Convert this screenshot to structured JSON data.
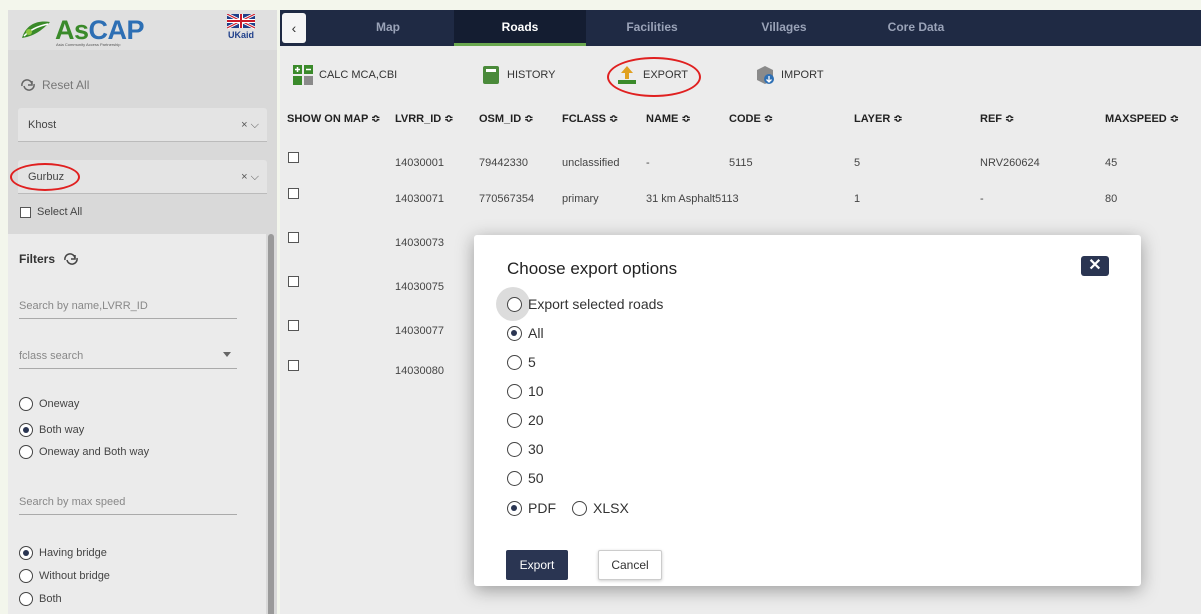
{
  "brand": {
    "logo_text_a": "As",
    "logo_text_b": "CAP",
    "tagline": "Asia Community Access Partnership",
    "ukaid": "UKaid"
  },
  "sidebar": {
    "reset_label": "Reset All",
    "province_value": "Khost",
    "district_value": "Gurbuz",
    "clear_symbol": "×",
    "select_all_label": "Select All",
    "filters_title": "Filters",
    "search_placeholder": "Search by name,LVRR_ID",
    "fclass_placeholder": "fclass search",
    "direction_options": [
      {
        "label": "Oneway",
        "selected": false
      },
      {
        "label": "Both way",
        "selected": true
      },
      {
        "label": "Oneway and Both way",
        "selected": false
      }
    ],
    "max_speed_placeholder": "Search by max speed",
    "bridge_options": [
      {
        "label": "Having bridge",
        "selected": true
      },
      {
        "label": "Without bridge",
        "selected": false
      },
      {
        "label": "Both",
        "selected": false
      }
    ]
  },
  "tabs": [
    {
      "label": "Map",
      "active": false
    },
    {
      "label": "Roads",
      "active": true
    },
    {
      "label": "Facilities",
      "active": false
    },
    {
      "label": "Villages",
      "active": false
    },
    {
      "label": "Core Data",
      "active": false
    }
  ],
  "toolbar": {
    "calc_label": "CALC MCA,CBI",
    "history_label": "HISTORY",
    "export_label": "EXPORT",
    "import_label": "IMPORT"
  },
  "table": {
    "headers": [
      "SHOW ON MAP ≎",
      "LVRR_ID ≎",
      "OSM_ID ≎",
      "FCLASS ≎",
      "NAME ≎",
      "CODE ≎",
      "LAYER ≎",
      "REF ≎",
      "MAXSPEED ≎"
    ],
    "rows": [
      {
        "lvrr_id": "14030001",
        "osm_id": "79442330",
        "fclass": "unclassified",
        "name": "-",
        "code": "5115",
        "layer": "5",
        "ref": "NRV260624",
        "maxspeed": "45"
      },
      {
        "lvrr_id": "14030071",
        "osm_id": "770567354",
        "fclass": "primary",
        "name": "31 km Asphalt",
        "code": "5113",
        "layer": "1",
        "ref": "-",
        "maxspeed": "80"
      },
      {
        "lvrr_id": "14030073"
      },
      {
        "lvrr_id": "14030075"
      },
      {
        "lvrr_id": "14030077"
      },
      {
        "lvrr_id": "14030080"
      }
    ]
  },
  "modal": {
    "title": "Choose export options",
    "close_symbol": "✕",
    "options": [
      {
        "label": "Export selected roads",
        "selected": false
      },
      {
        "label": "All",
        "selected": true
      },
      {
        "label": "5",
        "selected": false
      },
      {
        "label": "10",
        "selected": false
      },
      {
        "label": "20",
        "selected": false
      },
      {
        "label": "30",
        "selected": false
      },
      {
        "label": "50",
        "selected": false
      }
    ],
    "format_options": [
      {
        "label": "PDF",
        "selected": true
      },
      {
        "label": "XLSX",
        "selected": false
      }
    ],
    "export_button": "Export",
    "cancel_button": "Cancel"
  },
  "colors": {
    "navy": "#1f2a44",
    "accent_green": "#6aa84f",
    "highlight_red": "#e02020",
    "button_navy": "#2a3552"
  }
}
